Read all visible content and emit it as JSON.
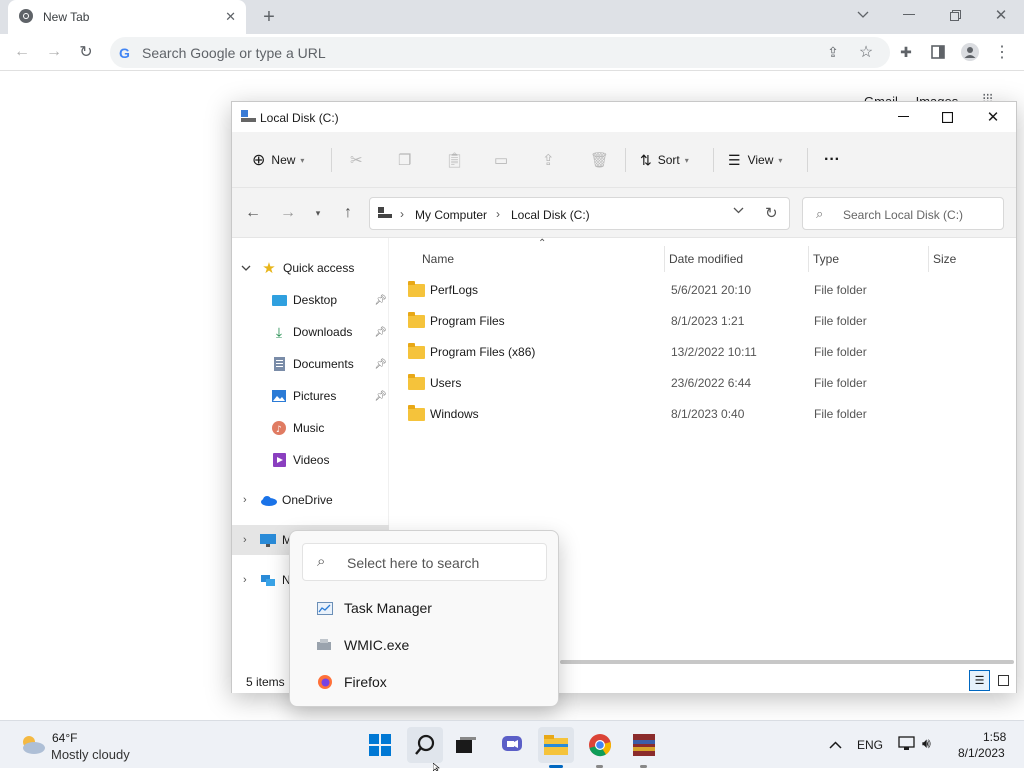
{
  "browser": {
    "tab_title": "New Tab",
    "omnibox_placeholder": "Search Google or type a URL",
    "ntp_links": [
      "Gmail",
      "Images"
    ]
  },
  "explorer": {
    "title": "Local Disk (C:)",
    "commands": {
      "new": "New",
      "sort": "Sort",
      "view": "View",
      "more": "···"
    },
    "breadcrumb": [
      "My Computer",
      "Local Disk (C:)"
    ],
    "search_placeholder": "Search Local Disk (C:)",
    "nav": {
      "quick_access": "Quick access",
      "items": [
        {
          "label": "Desktop",
          "icon": "desktop-icon",
          "pinned": true
        },
        {
          "label": "Downloads",
          "icon": "downloads-icon",
          "pinned": true
        },
        {
          "label": "Documents",
          "icon": "documents-icon",
          "pinned": true
        },
        {
          "label": "Pictures",
          "icon": "pictures-icon",
          "pinned": true
        },
        {
          "label": "Music",
          "icon": "music-icon",
          "pinned": false
        },
        {
          "label": "Videos",
          "icon": "videos-icon",
          "pinned": false
        }
      ],
      "onedrive": "OneDrive",
      "mycomputer_partial": "M",
      "network_partial": "N"
    },
    "columns": {
      "name": "Name",
      "date": "Date modified",
      "type": "Type",
      "size": "Size"
    },
    "rows": [
      {
        "name": "PerfLogs",
        "date": "5/6/2021 20:10",
        "type": "File folder"
      },
      {
        "name": "Program Files",
        "date": "8/1/2023 1:21",
        "type": "File folder"
      },
      {
        "name": "Program Files (x86)",
        "date": "13/2/2022 10:11",
        "type": "File folder"
      },
      {
        "name": "Users",
        "date": "23/6/2022 6:44",
        "type": "File folder"
      },
      {
        "name": "Windows",
        "date": "8/1/2023 0:40",
        "type": "File folder"
      }
    ],
    "status": "5 items"
  },
  "popup": {
    "search_placeholder": "Select here to search",
    "items": [
      "Task Manager",
      "WMIC.exe",
      "Firefox"
    ]
  },
  "taskbar": {
    "weather_temp": "64°F",
    "weather_desc": "Mostly cloudy",
    "lang": "ENG",
    "time": "1:58",
    "date": "8/1/2023"
  },
  "colors": {
    "accent": "#0067c0",
    "folder": "#f5c33b",
    "taskbar": "#eef1f6"
  }
}
